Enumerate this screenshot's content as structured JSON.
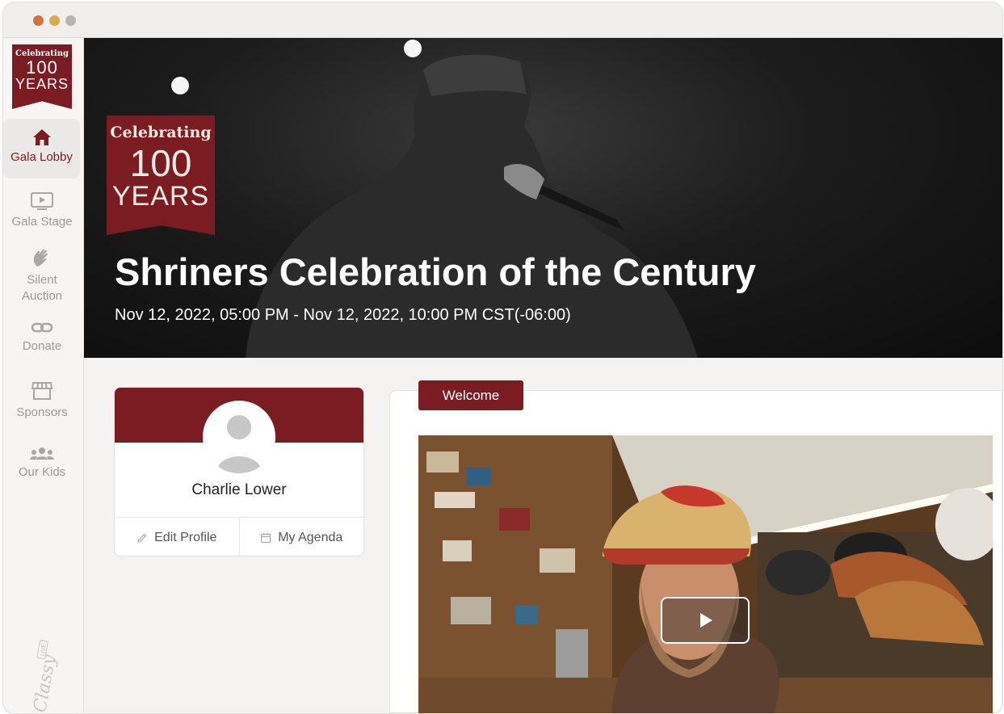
{
  "brand": {
    "logo_line1": "Celebrating",
    "logo_line2": "100",
    "logo_line3": "YEARS",
    "accent": "#7a1c22",
    "platform_watermark": "Classy LIVE"
  },
  "sidebar": {
    "items": [
      {
        "label": "Gala Lobby",
        "icon": "home-icon",
        "active": true
      },
      {
        "label": "Gala Stage",
        "icon": "play-screen-icon",
        "active": false
      },
      {
        "label": "Silent Auction",
        "icon": "hand-wave-icon",
        "active": false
      },
      {
        "label": "Donate",
        "icon": "link-icon",
        "active": false
      },
      {
        "label": "Sponsors",
        "icon": "storefront-icon",
        "active": false
      },
      {
        "label": "Our Kids",
        "icon": "people-group-icon",
        "active": false
      }
    ]
  },
  "hero": {
    "title": "Shriners Celebration of the Century",
    "date_range": "Nov 12, 2022, 05:00 PM - Nov 12, 2022, 10:00 PM CST(-06:00)"
  },
  "profile": {
    "name": "Charlie Lower",
    "edit_label": "Edit Profile",
    "agenda_label": "My Agenda"
  },
  "welcome": {
    "tab_label": "Welcome"
  }
}
